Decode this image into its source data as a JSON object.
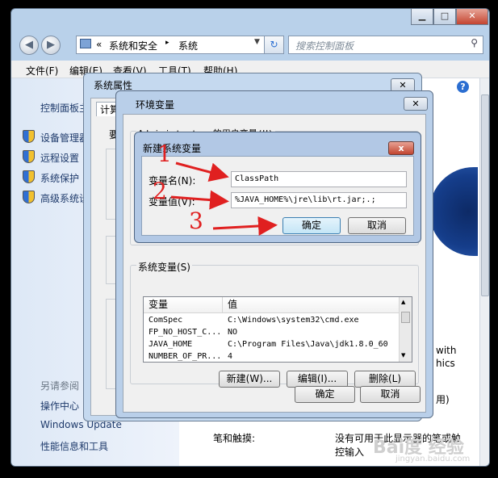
{
  "main_window": {
    "breadcrumb_prefix": "«",
    "breadcrumb_1": "系统和安全",
    "breadcrumb_sep": "▸",
    "breadcrumb_2": "系统",
    "search_placeholder": "搜索控制面板",
    "menu": [
      "文件(F)",
      "编辑(E)",
      "查看(V)",
      "工具(T)",
      "帮助(H)"
    ],
    "left_pane": {
      "home": "控制面板主页",
      "links": [
        "设备管理器",
        "远程设置",
        "系统保护",
        "高级系统设置"
      ],
      "see_also_title": "另请参阅",
      "see_also": [
        "操作中心",
        "Windows Update",
        "性能信息和工具"
      ]
    },
    "right_pane": {
      "text_with": "with",
      "text_hics": "hics",
      "text_pen": "笔和触摸:",
      "text_no_pen": "没有可用于此显示器的笔或触",
      "text_touch": "控输入",
      "text_paren": "用)"
    }
  },
  "sysprop_window": {
    "title": "系统属性",
    "tab_fragment": "计算",
    "body_fragment": "要"
  },
  "envvar_window": {
    "title": "环境变量",
    "user_vars_label": "Administrator 的用户变量(U)",
    "sysvars_label": "系统变量(S)",
    "col_variable": "变量",
    "col_value": "值",
    "rows": [
      {
        "name": "ComSpec",
        "value": "C:\\Windows\\system32\\cmd.exe"
      },
      {
        "name": "FP_NO_HOST_C...",
        "value": "NO"
      },
      {
        "name": "JAVA_HOME",
        "value": "C:\\Program Files\\Java\\jdk1.8.0_60"
      },
      {
        "name": "NUMBER_OF_PR...",
        "value": "4"
      }
    ],
    "btn_new": "新建(W)...",
    "btn_edit": "编辑(I)...",
    "btn_delete": "删除(L)",
    "btn_ok": "确定",
    "btn_cancel": "取消"
  },
  "newvar_dialog": {
    "title": "新建系统变量",
    "close_glyph": "x",
    "name_label": "变量名(N):",
    "name_value": "ClassPath",
    "value_label": "变量值(V):",
    "value_value": "%JAVA_HOME%\\jre\\lib\\rt.jar;.;",
    "btn_ok": "确定",
    "btn_cancel": "取消"
  },
  "annotations": {
    "step1": "1",
    "step2": "2",
    "step3": "3",
    "color": "#e02020"
  },
  "watermark": {
    "logo": "Bai度 经验",
    "url": "jingyan.baidu.com"
  }
}
